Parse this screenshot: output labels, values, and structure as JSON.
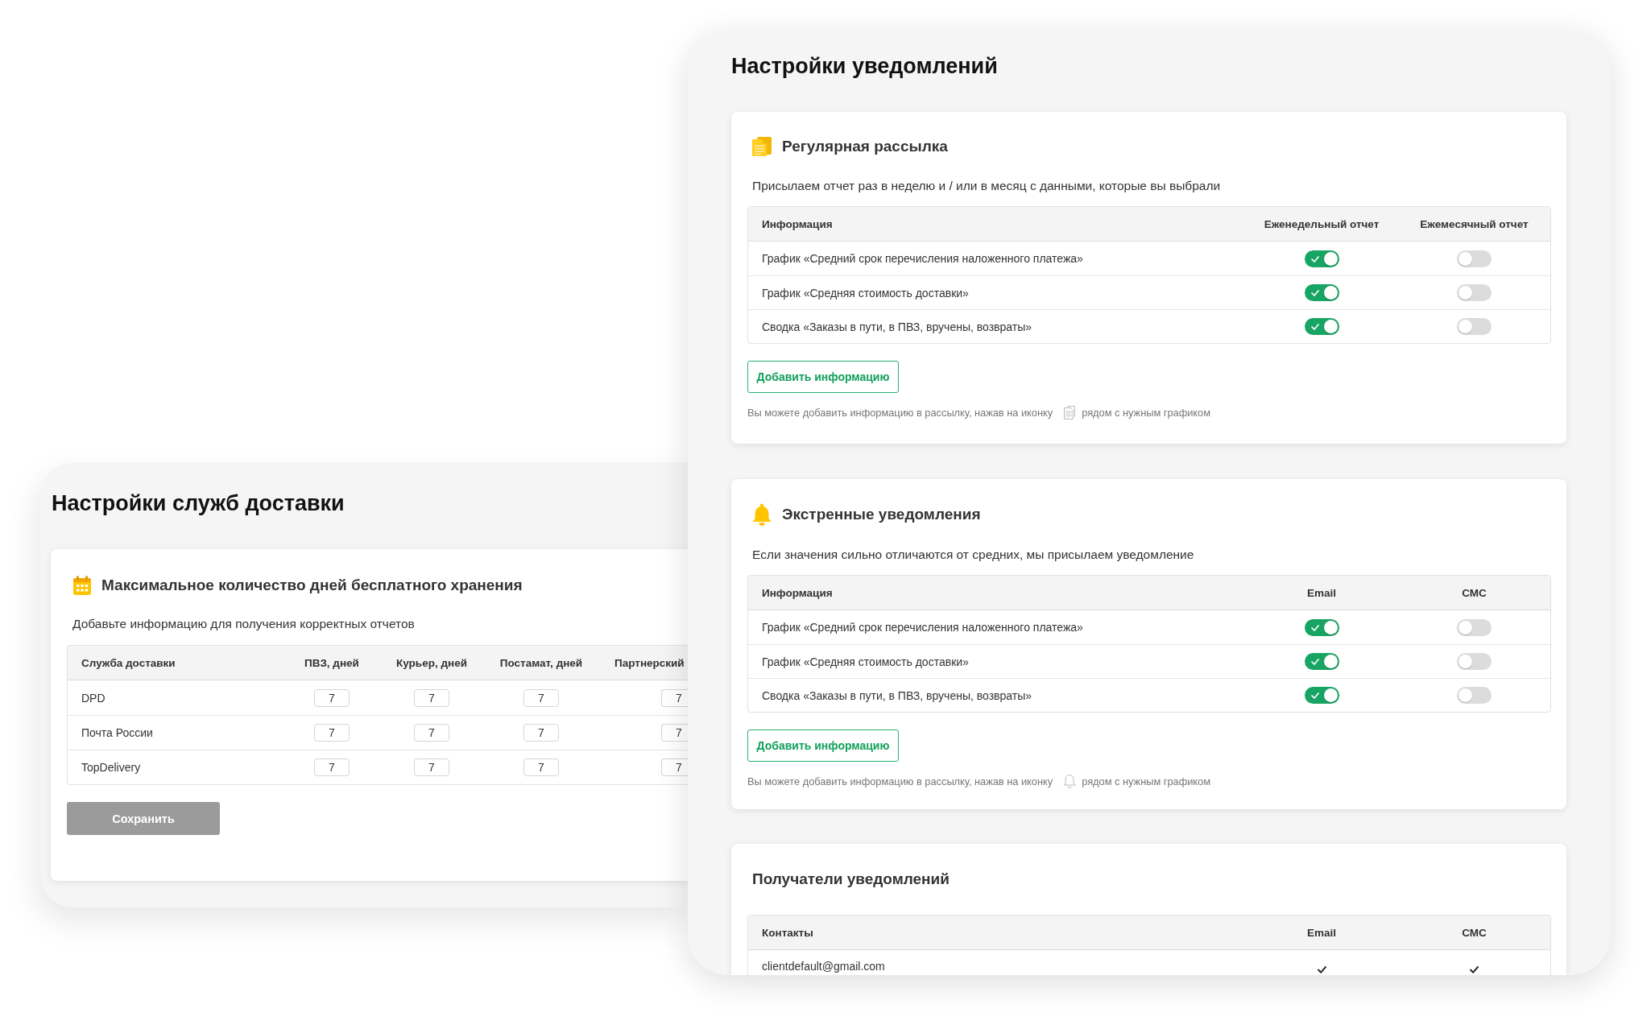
{
  "delivery_window": {
    "title": "Настройки служб доставки",
    "storage_card": {
      "title": "Максимальное количество дней бесплатного хранения",
      "subtitle": "Добавьте информацию для получения корректных отчетов",
      "table": {
        "columns": [
          "Служба доставки",
          "ПВЗ, дней",
          "Курьер, дней",
          "Постамат, дней",
          "Партнерский"
        ],
        "rows": [
          {
            "service": "DPD",
            "days": [
              "7",
              "7",
              "7",
              "7"
            ]
          },
          {
            "service": "Почта России",
            "days": [
              "7",
              "7",
              "7",
              "7"
            ]
          },
          {
            "service": "TopDelivery",
            "days": [
              "7",
              "7",
              "7",
              "7"
            ]
          }
        ]
      },
      "save_button": {
        "label": "Сохранить",
        "disabled": true
      }
    }
  },
  "notifications_window": {
    "title": "Настройки уведомлений",
    "regular_mailing": {
      "title": "Регулярная рассылка",
      "subtitle": "Присылаем отчет раз в неделю и / или в месяц с данными, которые вы выбрали",
      "table": {
        "columns": [
          "Информация",
          "Еженедельный отчет",
          "Ежемесячный отчет"
        ],
        "rows": [
          {
            "label": "График «Средний срок перечисления наложенного платежа»",
            "on": [
              true,
              false
            ]
          },
          {
            "label": "График «Средняя стоимость доставки»",
            "on": [
              true,
              false
            ]
          },
          {
            "label": "Сводка «Заказы в пути, в ПВЗ, вручены, возвраты»",
            "on": [
              true,
              false
            ]
          }
        ]
      },
      "add_button": "Добавить информацию",
      "hint_start": "Вы можете добавить информацию в рассылку, нажав на иконку",
      "hint_end": "рядом с нужным графиком"
    },
    "emergency_alerts": {
      "title": "Экстренные уведомления",
      "subtitle": "Если значения сильно отличаются от средних, мы присылаем уведомление",
      "table": {
        "columns": [
          "Информация",
          "Email",
          "СМС"
        ],
        "rows": [
          {
            "label": "График «Средний срок перечисления наложенного платежа»",
            "on": [
              true,
              false
            ]
          },
          {
            "label": "График «Средняя стоимость доставки»",
            "on": [
              true,
              false
            ]
          },
          {
            "label": "Сводка «Заказы в пути, в ПВЗ, вручены, возвраты»",
            "on": [
              true,
              false
            ]
          }
        ]
      },
      "add_button": "Добавить информацию",
      "hint_start": "Вы можете добавить информацию в рассылку, нажав на иконку",
      "hint_end": "рядом с нужным графиком"
    },
    "recipients": {
      "title": "Получатели уведомлений",
      "table": {
        "columns": [
          "Контакты",
          "Email",
          "СМС"
        ],
        "rows": [
          {
            "contact": "clientdefault@gmail.com",
            "checked": [
              true,
              true
            ]
          }
        ]
      }
    }
  }
}
